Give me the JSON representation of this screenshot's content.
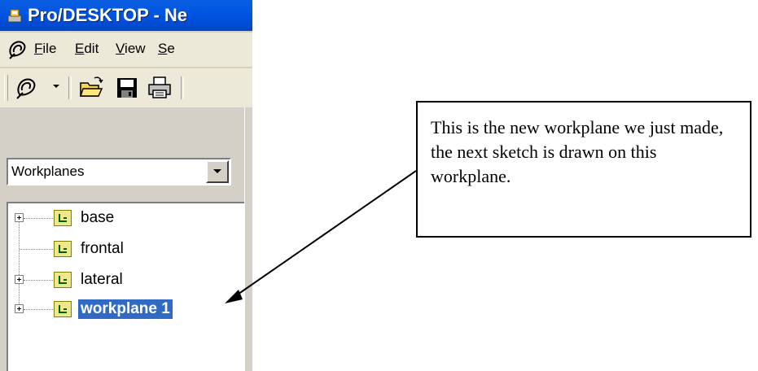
{
  "window": {
    "title": "Pro/DESKTOP - Ne"
  },
  "menubar": {
    "items": [
      {
        "label": "File",
        "underline": "F"
      },
      {
        "label": "Edit",
        "underline": "E"
      },
      {
        "label": "View",
        "underline": "V"
      },
      {
        "label": "Se",
        "underline": "S"
      }
    ]
  },
  "toolbar": {
    "buttons": [
      {
        "icon": "pro-desktop-icon"
      },
      {
        "icon": "dropdown-arrow-icon"
      },
      {
        "icon": "open-folder-icon"
      },
      {
        "icon": "save-icon"
      },
      {
        "icon": "print-icon"
      }
    ]
  },
  "browser": {
    "dropdown_value": "Workplanes",
    "tree": [
      {
        "label": "base",
        "expandable": true,
        "selected": false
      },
      {
        "label": "frontal",
        "expandable": false,
        "selected": false
      },
      {
        "label": "lateral",
        "expandable": true,
        "selected": false
      },
      {
        "label": "workplane 1",
        "expandable": true,
        "selected": true
      }
    ]
  },
  "callout": {
    "text": "This is the new workplane we just made, the next sketch is drawn on this workplane."
  },
  "colors": {
    "titlebar": "#0054e3",
    "selection": "#316ac5",
    "workplane_icon": "#f0e68c"
  }
}
